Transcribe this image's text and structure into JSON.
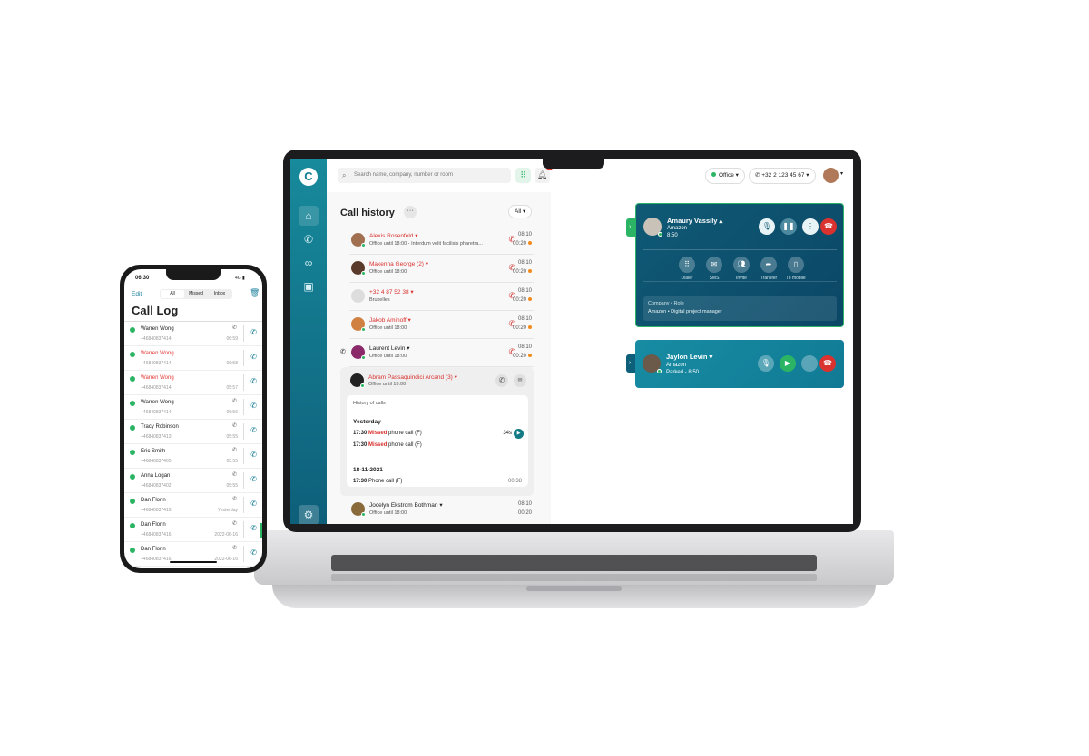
{
  "laptop": {
    "search_placeholder": "Search name, company, number or room",
    "status": "Office",
    "status_color": "#2bb463",
    "phone_number": "+32 2 123 45 67",
    "notification_count": "0",
    "brand_color": "#137f92",
    "sidebar": [
      "home-icon",
      "phone-icon",
      "voicemail-icon",
      "contacts-icon"
    ],
    "history": {
      "title": "Call history",
      "filter": "All",
      "rows": [
        {
          "name": "Alexis Rosenfeld",
          "sub": "Office until 18:00 - Interdum velit facilisis pharetra...",
          "time": "08:10",
          "duration": "00:20",
          "missed": true
        },
        {
          "name": "Makenna George (2)",
          "sub": "Office until 18:00",
          "time": "08:10",
          "duration": "00:20",
          "missed": true
        },
        {
          "name": "+32 4 87 52 38",
          "sub": "Bruxelles",
          "time": "08:10",
          "duration": "00:20",
          "missed": true
        },
        {
          "name": "Jakob Aminoff",
          "sub": "Office until 18:00",
          "time": "08:10",
          "duration": "00:20",
          "missed": true
        },
        {
          "name": "Laurent Levin",
          "sub": "Office until 18:00",
          "time": "08:10",
          "duration": "00:20",
          "missed": false
        }
      ],
      "expanded": {
        "name": "Abram Passaquindici Arcand (3)",
        "sub": "Office until 18:00",
        "history_label": "History of calls",
        "groups": [
          {
            "date": "Yesterday",
            "calls": [
              {
                "time": "17:30",
                "status": "Missed",
                "desc": "phone call (F)",
                "extra": "34s"
              },
              {
                "time": "17:30",
                "status": "Missed",
                "desc": "phone call (F)",
                "extra": ""
              }
            ]
          },
          {
            "date": "18-11-2021",
            "calls": [
              {
                "time": "17:30",
                "status": "",
                "desc": "Phone call (F)",
                "extra": "00:38"
              }
            ]
          }
        ]
      },
      "last": {
        "name": "Jocelyn Ekstrom Bothman",
        "sub": "Office until 18:00",
        "time": "08:10",
        "duration": "00:20"
      }
    },
    "active_call": {
      "name": "Amaury Vassily",
      "company": "Amazon",
      "timer": "8:50",
      "actions": [
        "Dialer",
        "SMS",
        "Invite",
        "Transfer",
        "To mobile"
      ],
      "info_label": "Company • Role",
      "info_value": "Amazon • Digital project manager"
    },
    "parked_call": {
      "name": "Jaylon Levin",
      "company": "Amazon",
      "status": "Parked - 8:50"
    }
  },
  "phone": {
    "time": "06:30",
    "network": "4G",
    "edit": "Edit",
    "tabs": [
      "All",
      "Missed",
      "Inbox"
    ],
    "title": "Call Log",
    "rows": [
      {
        "name": "Warren Wong",
        "number": "+46840837414",
        "time": "06:59",
        "missed": false
      },
      {
        "name": "Warren Wong",
        "number": "+46840837414",
        "time": "06:58",
        "missed": true
      },
      {
        "name": "Warren Wong",
        "number": "+46840837414",
        "time": "05:57",
        "missed": true
      },
      {
        "name": "Warren Wong",
        "number": "+46840837414",
        "time": "06:56",
        "missed": false
      },
      {
        "name": "Tracy Robinson",
        "number": "+46840837413",
        "time": "05:55",
        "missed": false
      },
      {
        "name": "Eric Smith",
        "number": "+46840837405",
        "time": "05:55",
        "missed": false
      },
      {
        "name": "Anna Logan",
        "number": "+46840837402",
        "time": "05:55",
        "missed": false
      },
      {
        "name": "Dan Florin",
        "number": "+46840837416",
        "time": "Yesterday",
        "missed": false
      },
      {
        "name": "Dan Florin",
        "number": "+46840837416",
        "time": "2022-06-16",
        "missed": false
      },
      {
        "name": "Dan Florin",
        "number": "+46840837416",
        "time": "2022-06-16",
        "missed": false
      }
    ]
  }
}
